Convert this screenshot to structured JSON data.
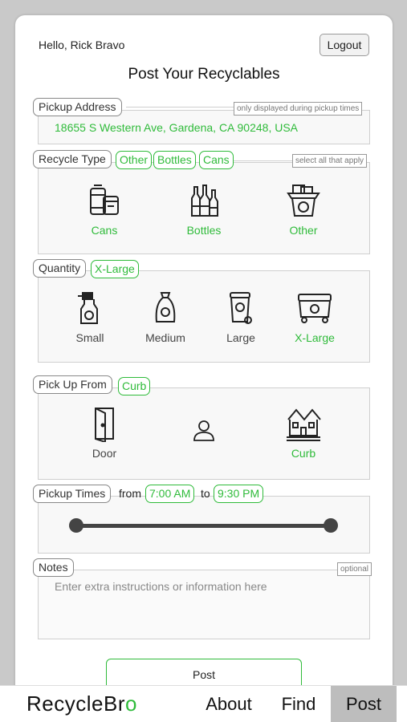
{
  "header": {
    "greeting": "Hello, Rick Bravo",
    "logout_label": "Logout",
    "title": "Post Your Recyclables"
  },
  "address_section": {
    "label": "Pickup Address",
    "hint": "only displayed during pickup times",
    "value": "18655 S Western Ave, Gardena, CA 90248, USA"
  },
  "recycle_type": {
    "label": "Recycle Type",
    "selected": [
      "Other",
      "Bottles",
      "Cans"
    ],
    "hint": "select all that apply",
    "options": [
      {
        "label": "Cans",
        "icon": "cans-icon",
        "selected": true
      },
      {
        "label": "Bottles",
        "icon": "bottles-icon",
        "selected": true
      },
      {
        "label": "Other",
        "icon": "recycle-bin-icon",
        "selected": true
      }
    ]
  },
  "quantity": {
    "label": "Quantity",
    "selected": "X-Large",
    "options": [
      {
        "label": "Small",
        "icon": "spray-bottle-icon",
        "selected": false
      },
      {
        "label": "Medium",
        "icon": "bag-icon",
        "selected": false
      },
      {
        "label": "Large",
        "icon": "trash-can-icon",
        "selected": false
      },
      {
        "label": "X-Large",
        "icon": "dumpster-icon",
        "selected": true
      }
    ]
  },
  "pickup_from": {
    "label": "Pick Up From",
    "selected": "Curb",
    "options": [
      {
        "label": "Door",
        "icon": "door-icon",
        "selected": false
      },
      {
        "label": "Curb",
        "icon": "house-icon",
        "selected": true
      }
    ],
    "person_icon": "person-icon"
  },
  "pickup_times": {
    "label": "Pickup Times",
    "from_label": "from",
    "from_value": "7:00 AM",
    "to_label": "to",
    "to_value": "9:30 PM",
    "range": [
      0,
      1
    ]
  },
  "notes": {
    "label": "Notes",
    "hint": "optional",
    "placeholder": "Enter extra instructions or information here"
  },
  "post_label": "Post",
  "navbar": {
    "brand_prefix": "RecycleBr",
    "brand_suffix": "o",
    "items": [
      {
        "label": "About",
        "active": false
      },
      {
        "label": "Find",
        "active": false
      },
      {
        "label": "Post",
        "active": true
      }
    ]
  },
  "colors": {
    "accent": "#2fbb3a",
    "active_nav": "#bdbdbd"
  }
}
